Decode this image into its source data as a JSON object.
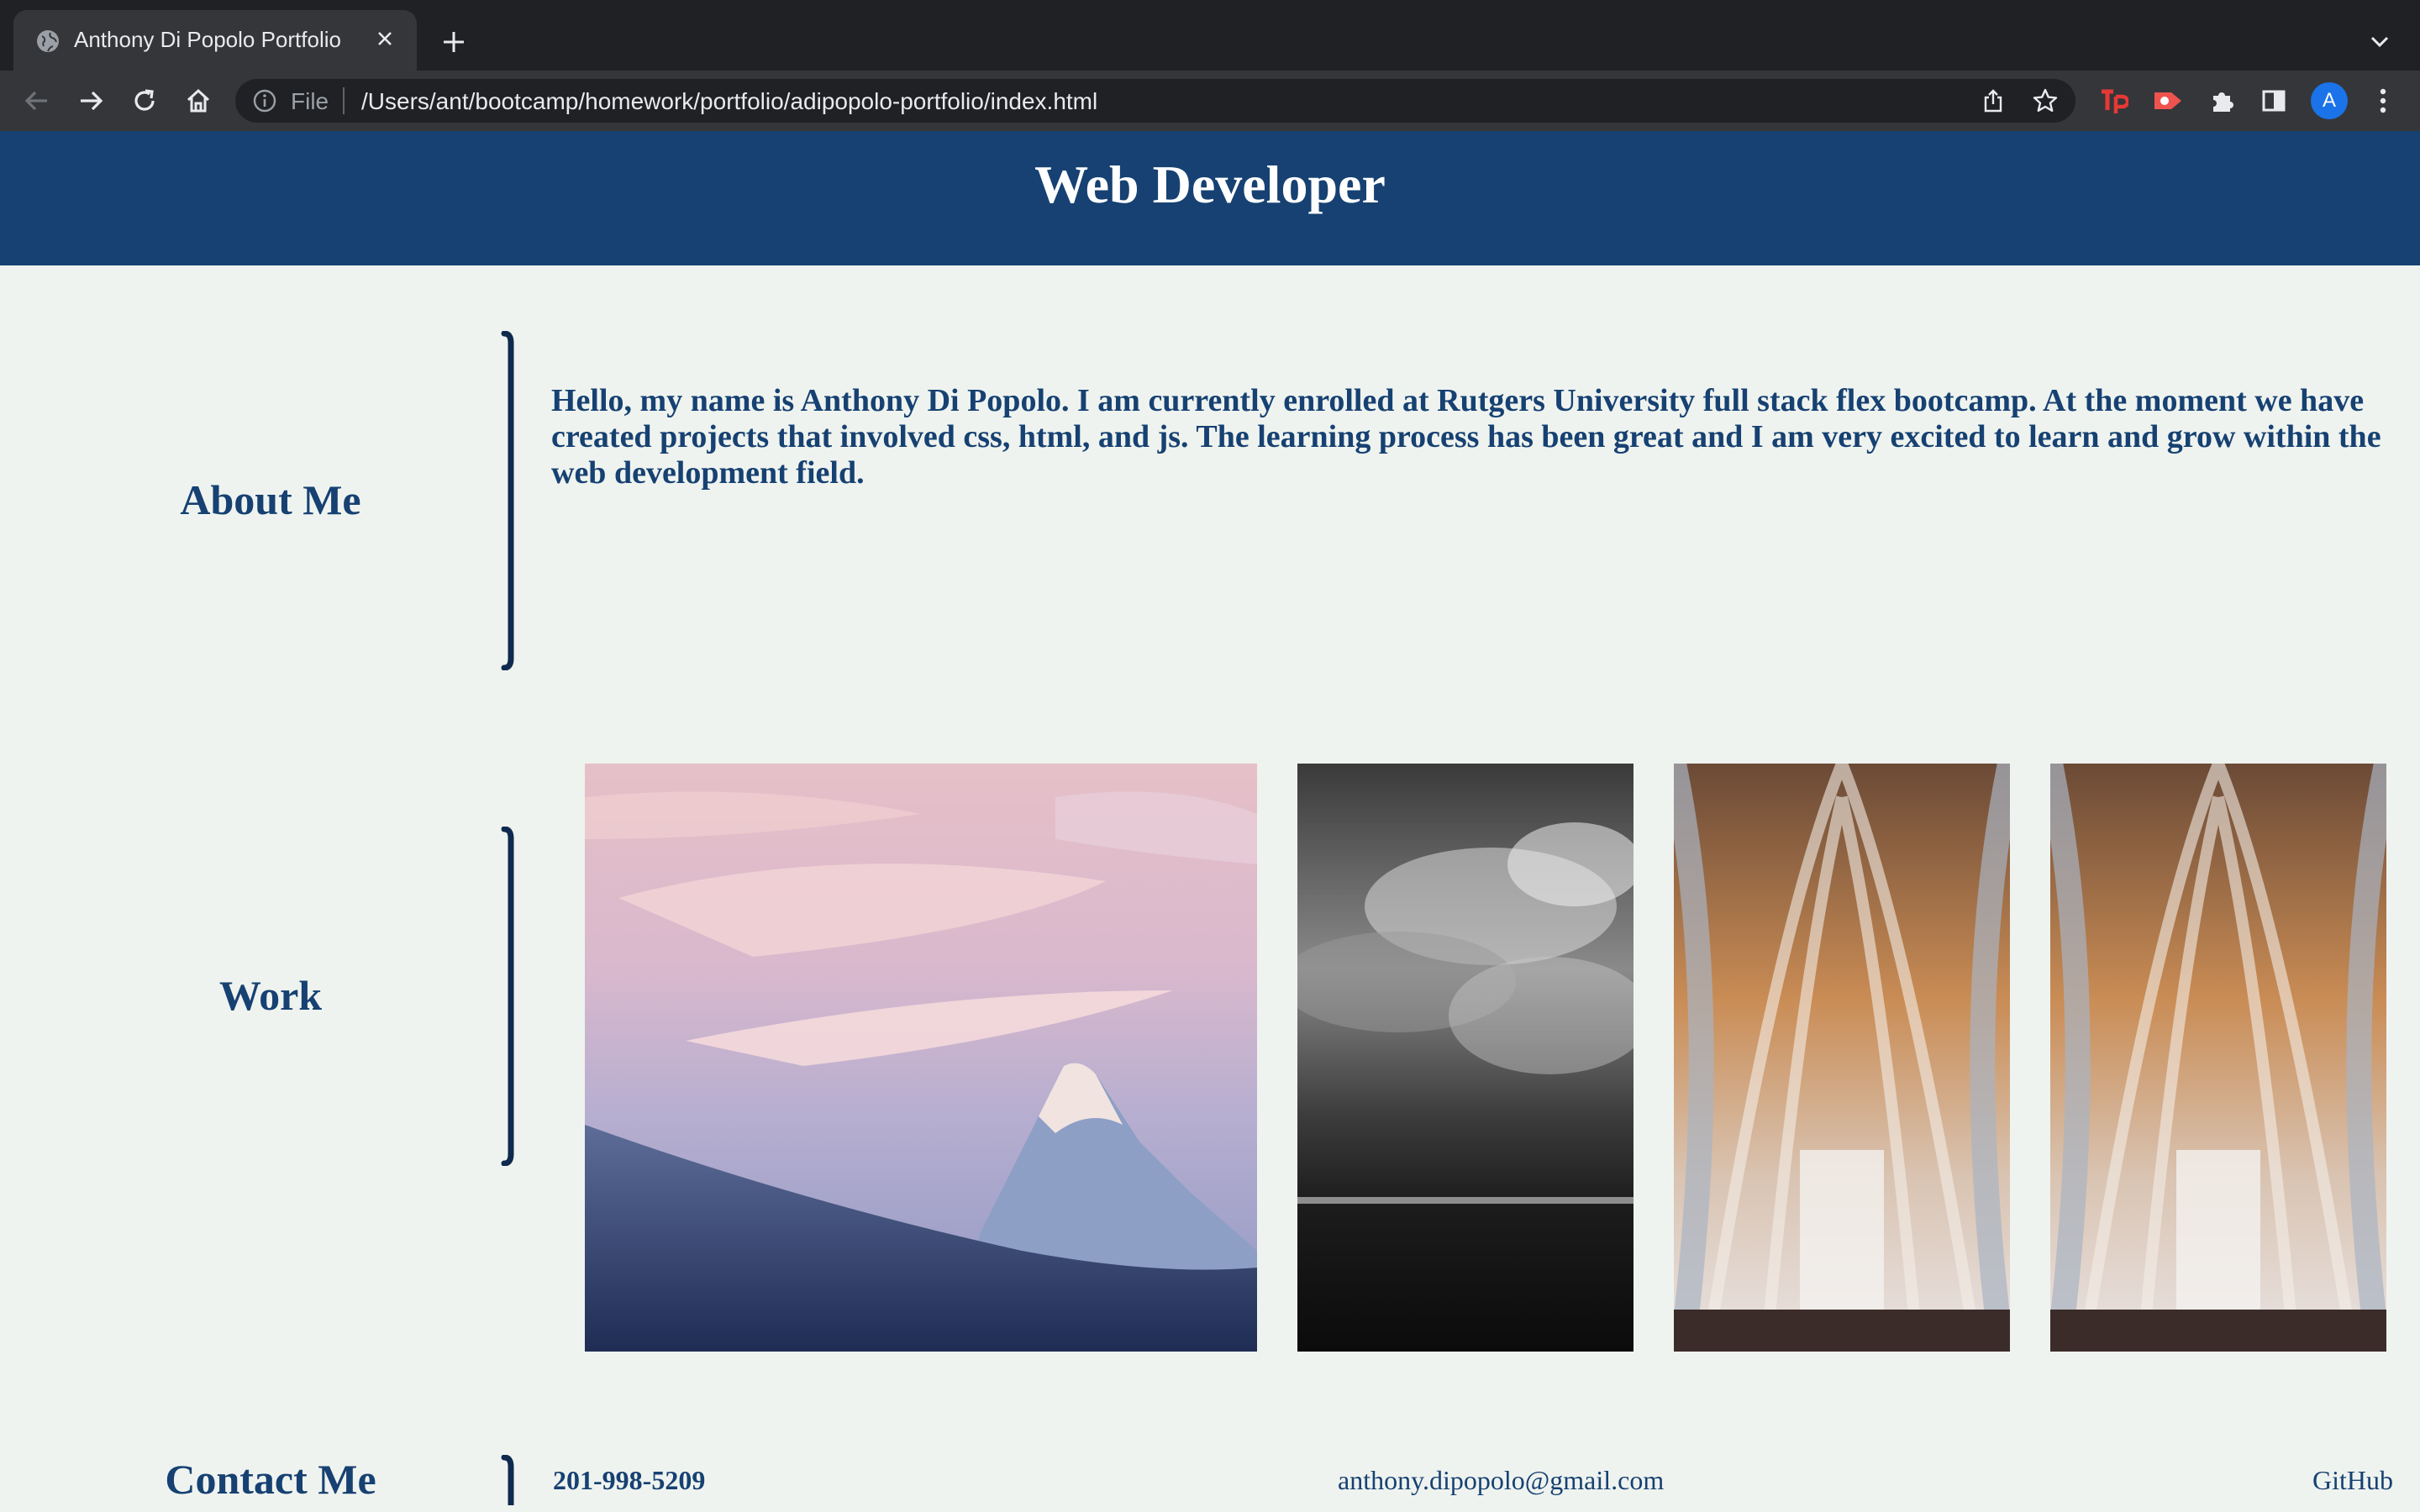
{
  "browser": {
    "tab_title": "Anthony Di Popolo Portfolio",
    "address_scheme": "File",
    "url": "/Users/ant/bootcamp/homework/portfolio/adipopolo-portfolio/index.html",
    "profile_initial": "A",
    "extensions": [
      "tp-extension-icon",
      "screen-recorder-icon",
      "puzzle-piece-icon",
      "side-panel-icon"
    ]
  },
  "header": {
    "title": "Web Developer"
  },
  "about": {
    "heading": "About Me",
    "text": "Hello, my name is Anthony Di Popolo. I am currently enrolled at Rutgers University full stack flex bootcamp. At the moment we have created projects that involved css, html, and js. The learning process has been great and I am very excited to learn and grow within the web development field."
  },
  "work": {
    "heading": "Work",
    "images": [
      {
        "subject": "snowy mountain peak at sunset"
      },
      {
        "subject": "black and white stormy sky over sea"
      },
      {
        "subject": "cathedral interior with tall arches"
      },
      {
        "subject": "cathedral interior with tall arches"
      }
    ]
  },
  "contact": {
    "heading": "Contact Me",
    "phone": "201-998-5209",
    "email": "anthony.dipopolo@gmail.com",
    "github": "GitHub"
  },
  "colors": {
    "brand_blue": "#164172",
    "page_background": "#eff3ef",
    "chrome_dark": "#202124",
    "chrome_toolbar": "#35363a"
  }
}
